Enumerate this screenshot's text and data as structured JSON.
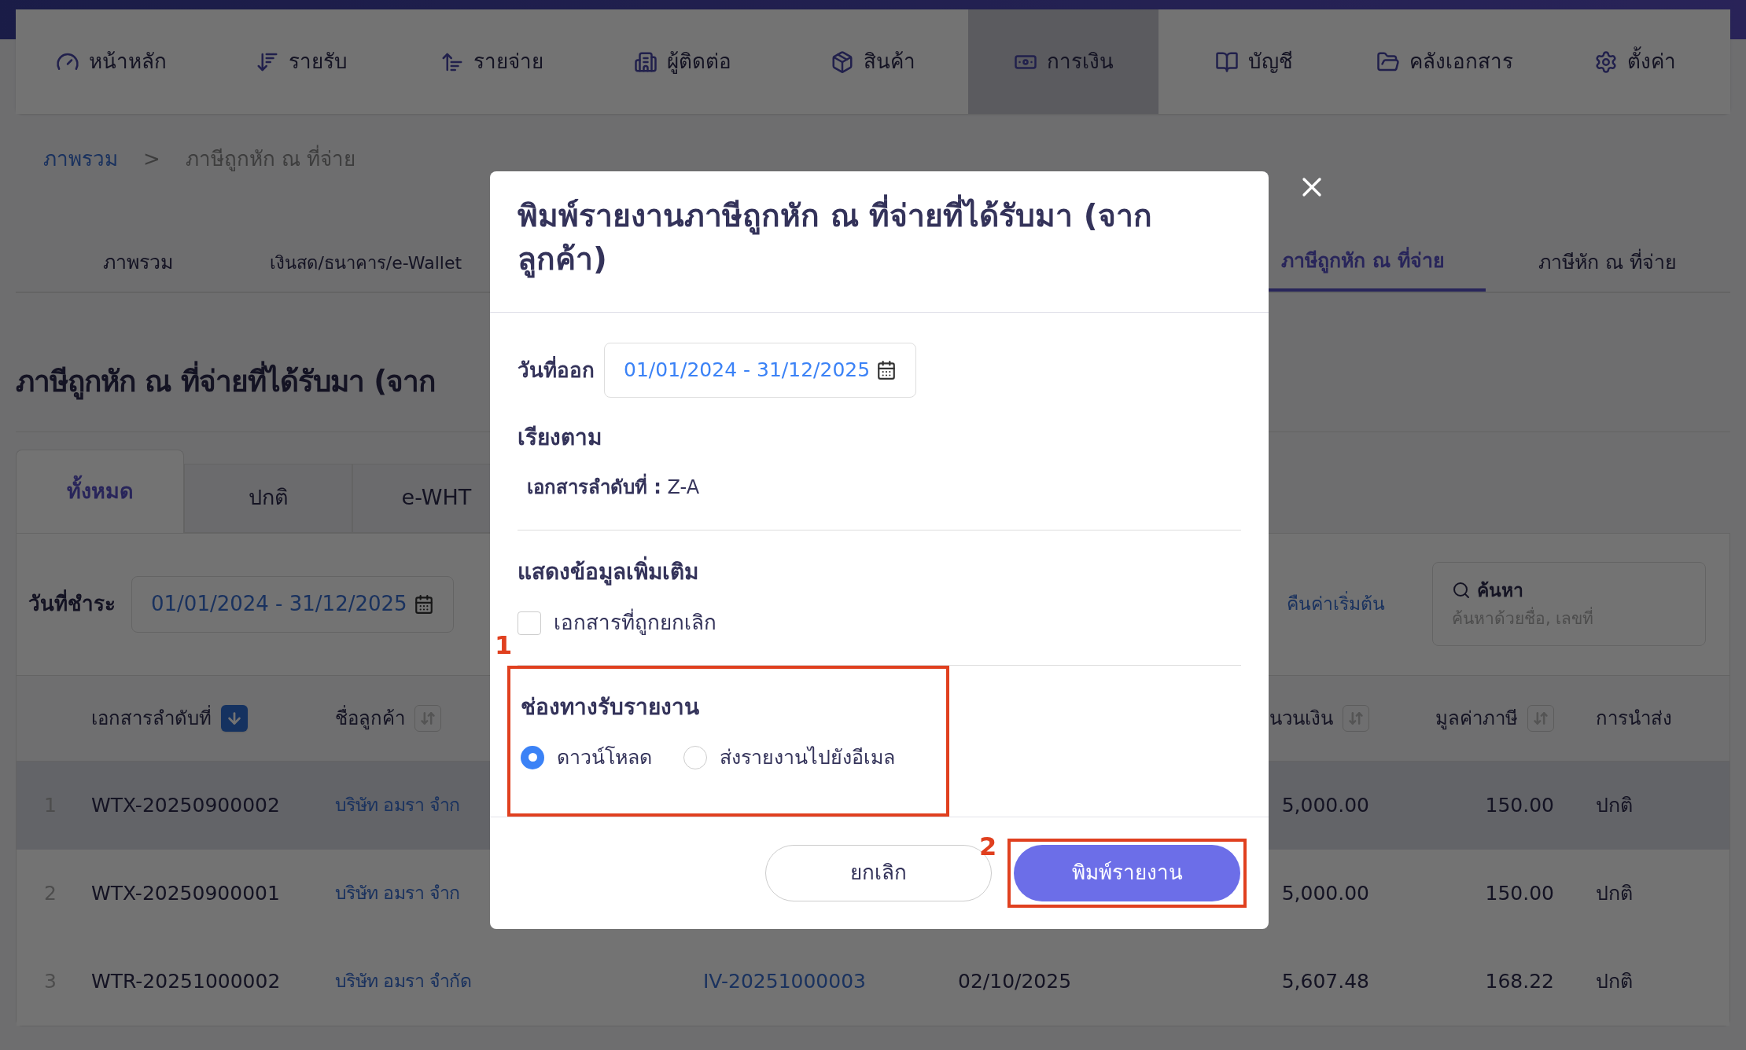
{
  "nav": {
    "items": [
      {
        "label": "หน้าหลัก",
        "selected": false
      },
      {
        "label": "รายรับ",
        "selected": false
      },
      {
        "label": "รายจ่าย",
        "selected": false
      },
      {
        "label": "ผู้ติดต่อ",
        "selected": false
      },
      {
        "label": "สินค้า",
        "selected": false
      },
      {
        "label": "การเงิน",
        "selected": true
      },
      {
        "label": "บัญชี",
        "selected": false
      },
      {
        "label": "คลังเอกสาร",
        "selected": false
      },
      {
        "label": "ตั้งค่า",
        "selected": false
      }
    ]
  },
  "breadcrumb": {
    "items": [
      "ภาพรวม",
      "ภาษีถูกหัก ณ ที่จ่าย"
    ],
    "separator": ">"
  },
  "subtabs": [
    {
      "label": "ภาพรวม",
      "selected": false
    },
    {
      "label": "เงินสด/ธนาคาร/e-Wallet",
      "selected": false
    },
    {
      "label": "ภาษีถูกหัก ณ ที่จ่าย",
      "selected": true
    },
    {
      "label": "ภาษีหัก ณ ที่จ่าย",
      "selected": false
    }
  ],
  "page_title": "ภาษีถูกหัก ณ ที่จ่ายที่ได้รับมา (จาก",
  "filter_tabs": [
    {
      "label": "ทั้งหมด",
      "selected": true
    },
    {
      "label": "ปกติ",
      "selected": false
    },
    {
      "label": "e-WHT",
      "selected": false
    }
  ],
  "filter": {
    "label": "วันที่ชำระ",
    "value": "01/01/2024 - 31/12/2025"
  },
  "reset_link": "คืนค่าเริ่มต้น",
  "search": {
    "label": "ค้นหา",
    "placeholder": "ค้นหาด้วยชื่อ, เลขที่"
  },
  "table": {
    "columns": [
      {
        "label": "เอกสารลำดับที่"
      },
      {
        "label": "ชื่อลูกค้า"
      },
      {
        "label": "นวนเงิน"
      },
      {
        "label": "มูลค่าภาษี"
      },
      {
        "label": "การนำส่ง"
      }
    ],
    "rows": [
      {
        "index": "1",
        "doc_no": "WTX-20250900002",
        "customer": "บริษัท อมรา จำก",
        "amount": "5,000.00",
        "tax": "150.00",
        "delivery": "ปกติ",
        "hovered": true
      },
      {
        "index": "2",
        "doc_no": "WTX-20250900001",
        "customer": "บริษัท อมรา จำก",
        "amount": "5,000.00",
        "tax": "150.00",
        "delivery": "ปกติ",
        "hovered": false
      },
      {
        "index": "3",
        "doc_no": "WTR-20251000002",
        "customer": "บริษัท อมรา จำกัด",
        "invoice": "IV-20251000003",
        "date": "02/10/2025",
        "amount": "5,607.48",
        "tax": "168.22",
        "delivery": "ปกติ",
        "hovered": false
      }
    ]
  },
  "modal": {
    "title": "พิมพ์รายงานภาษีถูกหัก ณ ที่จ่ายที่ได้รับมา (จากลูกค้า)",
    "date_field": {
      "label": "วันที่ออก",
      "value": "01/01/2024 - 31/12/2025"
    },
    "sort_section": {
      "heading": "เรียงตาม",
      "text": "**เอกสารลำดับที่ :** Z-A"
    },
    "extra_section": {
      "heading": "แสดงข้อมูลเพิ่มเติม",
      "options": [
        {
          "label": "เอกสารที่ถูกยกเลิก",
          "checked": false
        }
      ]
    },
    "channel_section": {
      "heading": "ช่องทางรับรายงาน",
      "annotation": "1",
      "options": [
        {
          "label": "ดาวน์โหลด",
          "selected": true
        },
        {
          "label": "ส่งรายงานไปยังอีเมล",
          "selected": false
        }
      ]
    },
    "buttons": [
      {
        "label": "ยกเลิก",
        "kind": "secondary"
      },
      {
        "label": "พิมพ์รายงาน",
        "kind": "primary",
        "annotation": "2"
      }
    ]
  }
}
